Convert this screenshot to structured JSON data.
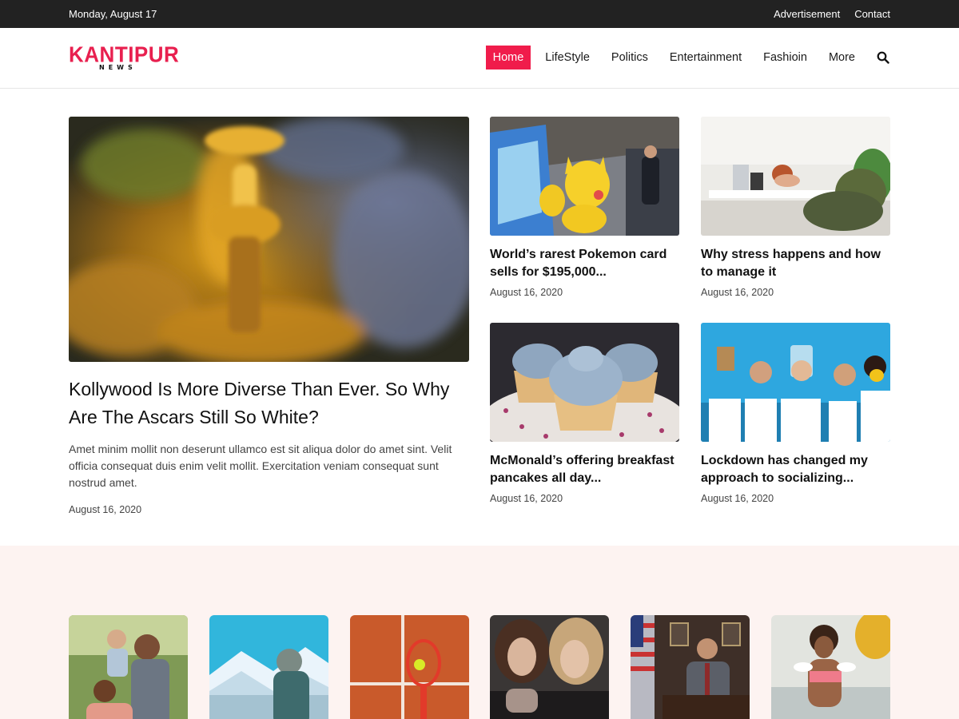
{
  "topbar": {
    "date": "Monday, August 17",
    "links": [
      "Advertisement",
      "Contact"
    ]
  },
  "logo": {
    "main": "KANTIPUR",
    "sub": "NEWS"
  },
  "nav": {
    "items": [
      "Home",
      "LifeStyle",
      "Politics",
      "Entertainment",
      "Fashioin",
      "More"
    ],
    "active": "Home",
    "search_icon": "search-icon"
  },
  "featured": {
    "title": "Kollywood Is More Diverse Than Ever. So Why Are The Ascars Still So White?",
    "excerpt": "Amet minim mollit non deserunt ullamco est sit aliqua dolor do amet sint. Velit officia consequat duis enim velit mollit. Exercitation veniam consequat sunt nostrud amet.",
    "date": "August 16, 2020"
  },
  "cards": [
    {
      "title": "World’s rarest Pokemon card sells for $195,000...",
      "date": "August 16, 2020"
    },
    {
      "title": "Why stress happens and how to manage it",
      "date": "August 16, 2020"
    },
    {
      "title": "McMonald’s offering breakfast pancakes all day...",
      "date": "August 16, 2020"
    },
    {
      "title": "Lockdown has changed my approach to socializing...",
      "date": "August 16, 2020"
    }
  ],
  "colors": {
    "accent": "#f01c4b",
    "topbar": "#222222",
    "section_bg": "#fdf3f1"
  }
}
